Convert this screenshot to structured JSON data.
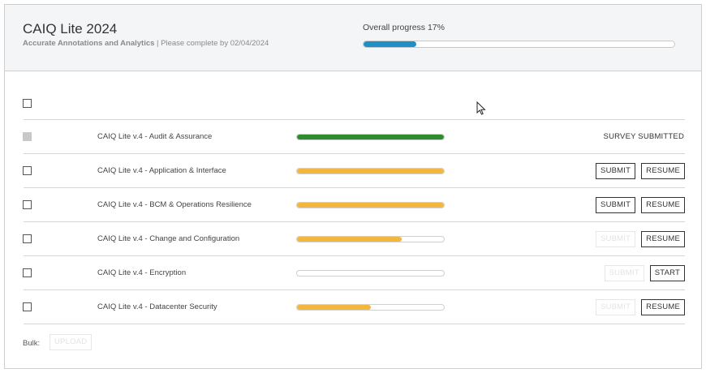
{
  "header": {
    "title": "CAIQ Lite 2024",
    "organization": "Accurate Annotations and Analytics",
    "separator": " | ",
    "deadline_text": "Please complete by 02/04/2024",
    "overall_progress_label": "Overall progress 17%",
    "overall_progress_fraction": 0.17,
    "overall_progress_color": "#1e8fc7"
  },
  "colors": {
    "complete": "#2e8b2e",
    "in_progress": "#f3b63f"
  },
  "surveys": [
    {
      "label": "CAIQ Lite v.4 - Audit & Assurance",
      "progress": 1.0,
      "color": "#2e8b2e",
      "checkbox_disabled": true,
      "status_text": "SURVEY SUBMITTED",
      "submit_label": null,
      "submit_enabled": false,
      "action_label": null
    },
    {
      "label": "CAIQ Lite v.4 - Application & Interface",
      "progress": 1.0,
      "color": "#f3b63f",
      "checkbox_disabled": false,
      "status_text": null,
      "submit_label": "SUBMIT",
      "submit_enabled": true,
      "action_label": "RESUME"
    },
    {
      "label": "CAIQ Lite v.4 - BCM & Operations Resilience",
      "progress": 1.0,
      "color": "#f3b63f",
      "checkbox_disabled": false,
      "status_text": null,
      "submit_label": "SUBMIT",
      "submit_enabled": true,
      "action_label": "RESUME"
    },
    {
      "label": "CAIQ Lite v.4 - Change and Configuration",
      "progress": 0.71,
      "color": "#f3b63f",
      "checkbox_disabled": false,
      "status_text": null,
      "submit_label": "SUBMIT",
      "submit_enabled": false,
      "action_label": "RESUME"
    },
    {
      "label": "CAIQ Lite v.4 - Encryption",
      "progress": 0.0,
      "color": "#f3b63f",
      "checkbox_disabled": false,
      "status_text": null,
      "submit_label": "SUBMIT",
      "submit_enabled": false,
      "action_label": "START"
    },
    {
      "label": "CAIQ Lite v.4 - Datacenter Security",
      "progress": 0.5,
      "color": "#f3b63f",
      "checkbox_disabled": false,
      "status_text": null,
      "submit_label": "SUBMIT",
      "submit_enabled": false,
      "action_label": "RESUME"
    }
  ],
  "bulk": {
    "label": "Bulk:",
    "upload_label": "UPLOAD"
  }
}
